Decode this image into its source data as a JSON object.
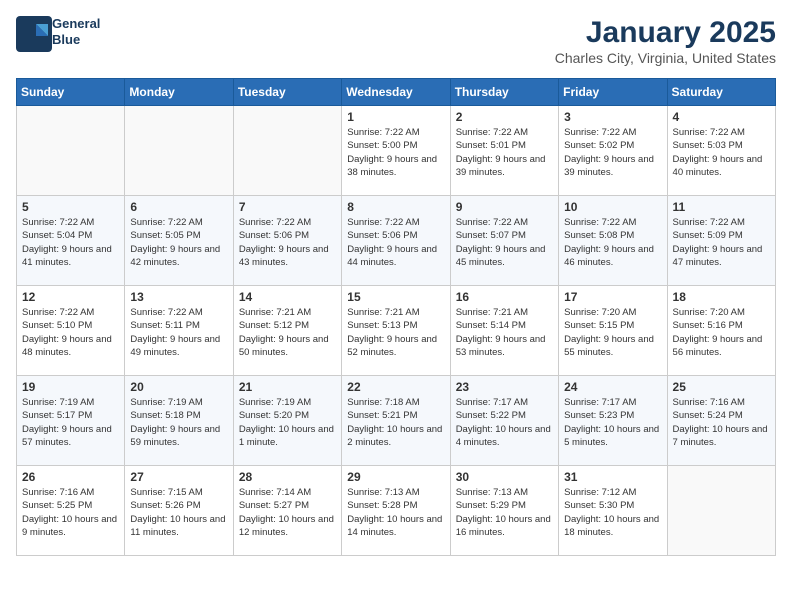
{
  "header": {
    "logo_line1": "General",
    "logo_line2": "Blue",
    "title": "January 2025",
    "subtitle": "Charles City, Virginia, United States"
  },
  "calendar": {
    "days_of_week": [
      "Sunday",
      "Monday",
      "Tuesday",
      "Wednesday",
      "Thursday",
      "Friday",
      "Saturday"
    ],
    "weeks": [
      [
        {
          "day": "",
          "info": ""
        },
        {
          "day": "",
          "info": ""
        },
        {
          "day": "",
          "info": ""
        },
        {
          "day": "1",
          "info": "Sunrise: 7:22 AM\nSunset: 5:00 PM\nDaylight: 9 hours and 38 minutes."
        },
        {
          "day": "2",
          "info": "Sunrise: 7:22 AM\nSunset: 5:01 PM\nDaylight: 9 hours and 39 minutes."
        },
        {
          "day": "3",
          "info": "Sunrise: 7:22 AM\nSunset: 5:02 PM\nDaylight: 9 hours and 39 minutes."
        },
        {
          "day": "4",
          "info": "Sunrise: 7:22 AM\nSunset: 5:03 PM\nDaylight: 9 hours and 40 minutes."
        }
      ],
      [
        {
          "day": "5",
          "info": "Sunrise: 7:22 AM\nSunset: 5:04 PM\nDaylight: 9 hours and 41 minutes."
        },
        {
          "day": "6",
          "info": "Sunrise: 7:22 AM\nSunset: 5:05 PM\nDaylight: 9 hours and 42 minutes."
        },
        {
          "day": "7",
          "info": "Sunrise: 7:22 AM\nSunset: 5:06 PM\nDaylight: 9 hours and 43 minutes."
        },
        {
          "day": "8",
          "info": "Sunrise: 7:22 AM\nSunset: 5:06 PM\nDaylight: 9 hours and 44 minutes."
        },
        {
          "day": "9",
          "info": "Sunrise: 7:22 AM\nSunset: 5:07 PM\nDaylight: 9 hours and 45 minutes."
        },
        {
          "day": "10",
          "info": "Sunrise: 7:22 AM\nSunset: 5:08 PM\nDaylight: 9 hours and 46 minutes."
        },
        {
          "day": "11",
          "info": "Sunrise: 7:22 AM\nSunset: 5:09 PM\nDaylight: 9 hours and 47 minutes."
        }
      ],
      [
        {
          "day": "12",
          "info": "Sunrise: 7:22 AM\nSunset: 5:10 PM\nDaylight: 9 hours and 48 minutes."
        },
        {
          "day": "13",
          "info": "Sunrise: 7:22 AM\nSunset: 5:11 PM\nDaylight: 9 hours and 49 minutes."
        },
        {
          "day": "14",
          "info": "Sunrise: 7:21 AM\nSunset: 5:12 PM\nDaylight: 9 hours and 50 minutes."
        },
        {
          "day": "15",
          "info": "Sunrise: 7:21 AM\nSunset: 5:13 PM\nDaylight: 9 hours and 52 minutes."
        },
        {
          "day": "16",
          "info": "Sunrise: 7:21 AM\nSunset: 5:14 PM\nDaylight: 9 hours and 53 minutes."
        },
        {
          "day": "17",
          "info": "Sunrise: 7:20 AM\nSunset: 5:15 PM\nDaylight: 9 hours and 55 minutes."
        },
        {
          "day": "18",
          "info": "Sunrise: 7:20 AM\nSunset: 5:16 PM\nDaylight: 9 hours and 56 minutes."
        }
      ],
      [
        {
          "day": "19",
          "info": "Sunrise: 7:19 AM\nSunset: 5:17 PM\nDaylight: 9 hours and 57 minutes."
        },
        {
          "day": "20",
          "info": "Sunrise: 7:19 AM\nSunset: 5:18 PM\nDaylight: 9 hours and 59 minutes."
        },
        {
          "day": "21",
          "info": "Sunrise: 7:19 AM\nSunset: 5:20 PM\nDaylight: 10 hours and 1 minute."
        },
        {
          "day": "22",
          "info": "Sunrise: 7:18 AM\nSunset: 5:21 PM\nDaylight: 10 hours and 2 minutes."
        },
        {
          "day": "23",
          "info": "Sunrise: 7:17 AM\nSunset: 5:22 PM\nDaylight: 10 hours and 4 minutes."
        },
        {
          "day": "24",
          "info": "Sunrise: 7:17 AM\nSunset: 5:23 PM\nDaylight: 10 hours and 5 minutes."
        },
        {
          "day": "25",
          "info": "Sunrise: 7:16 AM\nSunset: 5:24 PM\nDaylight: 10 hours and 7 minutes."
        }
      ],
      [
        {
          "day": "26",
          "info": "Sunrise: 7:16 AM\nSunset: 5:25 PM\nDaylight: 10 hours and 9 minutes."
        },
        {
          "day": "27",
          "info": "Sunrise: 7:15 AM\nSunset: 5:26 PM\nDaylight: 10 hours and 11 minutes."
        },
        {
          "day": "28",
          "info": "Sunrise: 7:14 AM\nSunset: 5:27 PM\nDaylight: 10 hours and 12 minutes."
        },
        {
          "day": "29",
          "info": "Sunrise: 7:13 AM\nSunset: 5:28 PM\nDaylight: 10 hours and 14 minutes."
        },
        {
          "day": "30",
          "info": "Sunrise: 7:13 AM\nSunset: 5:29 PM\nDaylight: 10 hours and 16 minutes."
        },
        {
          "day": "31",
          "info": "Sunrise: 7:12 AM\nSunset: 5:30 PM\nDaylight: 10 hours and 18 minutes."
        },
        {
          "day": "",
          "info": ""
        }
      ]
    ]
  }
}
